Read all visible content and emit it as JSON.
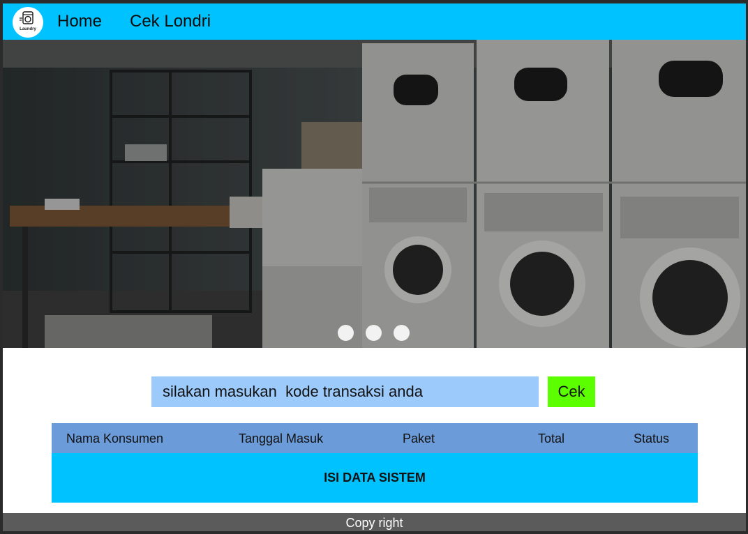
{
  "nav": {
    "logo_text": "Laundry",
    "links": [
      "Home",
      "Cek Londri"
    ]
  },
  "hero": {
    "image": "laundromat-photo",
    "slides_count": 3
  },
  "search": {
    "placeholder": "silakan masukan  kode transaksi anda",
    "button_label": "Cek"
  },
  "table": {
    "headers": [
      "Nama Konsumen",
      "Tanggal Masuk",
      "Paket",
      "Total",
      "Status"
    ],
    "body_text": "ISI DATA SISTEM"
  },
  "footer": {
    "text": "Copy right"
  },
  "colors": {
    "navbar": "#00c2ff",
    "search_bg": "#9ccbfb",
    "button_bg": "#5cff00",
    "table_header": "#6b9bd8",
    "table_body": "#00c2ff",
    "footer": "#5b5b5b"
  }
}
